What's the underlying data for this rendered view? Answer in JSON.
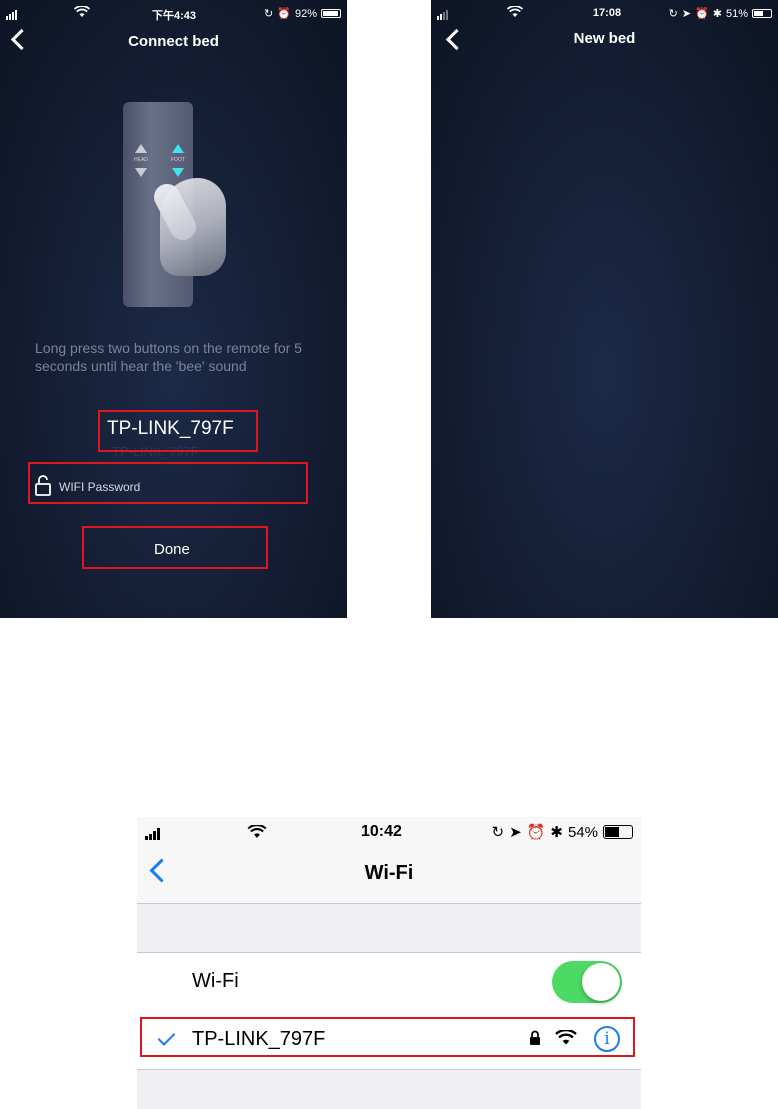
{
  "connect_screen": {
    "status": {
      "time": "下午4:43",
      "battery": "92%",
      "battery_level": 0.92
    },
    "title": "Connect bed",
    "remote": {
      "head_label": "HEAD",
      "foot_label": "FOOT"
    },
    "instruction": "Long press two buttons on the remote for 5 seconds until hear the 'bee' sound",
    "network_name": "TP-LINK_797F",
    "password_placeholder": "WIFI Password",
    "done_label": "Done"
  },
  "new_bed_screen": {
    "status": {
      "time": "17:08",
      "battery": "51%",
      "battery_level": 0.51
    },
    "title": "New bed"
  },
  "wifi_settings": {
    "status": {
      "time": "10:42",
      "battery": "54%",
      "battery_level": 0.54
    },
    "title": "Wi-Fi",
    "wifi_toggle_label": "Wi-Fi",
    "wifi_enabled": true,
    "connected_network": "TP-LINK_797F",
    "info_glyph": "i"
  },
  "colors": {
    "highlight": "#e0161f",
    "ios_blue": "#1a7cf0",
    "toggle_on": "#4cd964"
  },
  "icons": [
    "back-chevron-icon",
    "wifi-signal-icon",
    "lock-icon",
    "info-icon",
    "checkmark-icon",
    "unlock-icon",
    "battery-icon",
    "alarm-icon",
    "bluetooth-icon",
    "location-icon",
    "rotation-lock-icon"
  ]
}
